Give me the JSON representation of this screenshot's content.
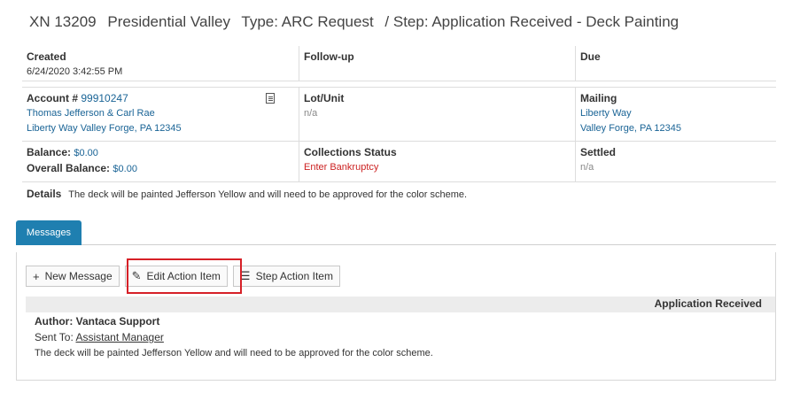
{
  "title": {
    "id": "XN 13209",
    "community": "Presidential Valley",
    "type": "Type: ARC Request",
    "step": "/ Step: Application Received - Deck Painting"
  },
  "created": {
    "label": "Created",
    "value": "6/24/2020 3:42:55 PM"
  },
  "followup": {
    "label": "Follow-up"
  },
  "due": {
    "label": "Due"
  },
  "account": {
    "label": "Account #",
    "number": "99910247",
    "owner": "Thomas Jefferson & Carl Rae",
    "address": "Liberty Way Valley Forge, PA 12345"
  },
  "lot": {
    "label": "Lot/Unit",
    "value": "n/a"
  },
  "mailing": {
    "label": "Mailing",
    "line1": "Liberty Way",
    "line2": "Valley Forge, PA 12345"
  },
  "balance": {
    "label": "Balance:",
    "value": "$0.00"
  },
  "overall": {
    "label": "Overall Balance:",
    "value": "$0.00"
  },
  "collections": {
    "label": "Collections Status",
    "value": "Enter Bankruptcy"
  },
  "settled": {
    "label": "Settled",
    "value": "n/a"
  },
  "details": {
    "label": "Details",
    "value": "The deck will be painted Jefferson Yellow and will need to be approved for the color scheme."
  },
  "tabs": {
    "messages": "Messages"
  },
  "toolbar": {
    "new_message": "New Message",
    "edit_action": "Edit Action Item",
    "step_action": "Step Action Item"
  },
  "message": {
    "status": "Application Received",
    "author": "Author: Vantaca Support",
    "sent_to_label": "Sent To:",
    "sent_to": "Assistant Manager",
    "text": "The deck will be painted Jefferson Yellow and will need to be approved for the color scheme."
  },
  "icons": {
    "doc": "document-icon",
    "plus": "plus-icon",
    "pencil": "pencil-icon",
    "list": "list-icon"
  }
}
